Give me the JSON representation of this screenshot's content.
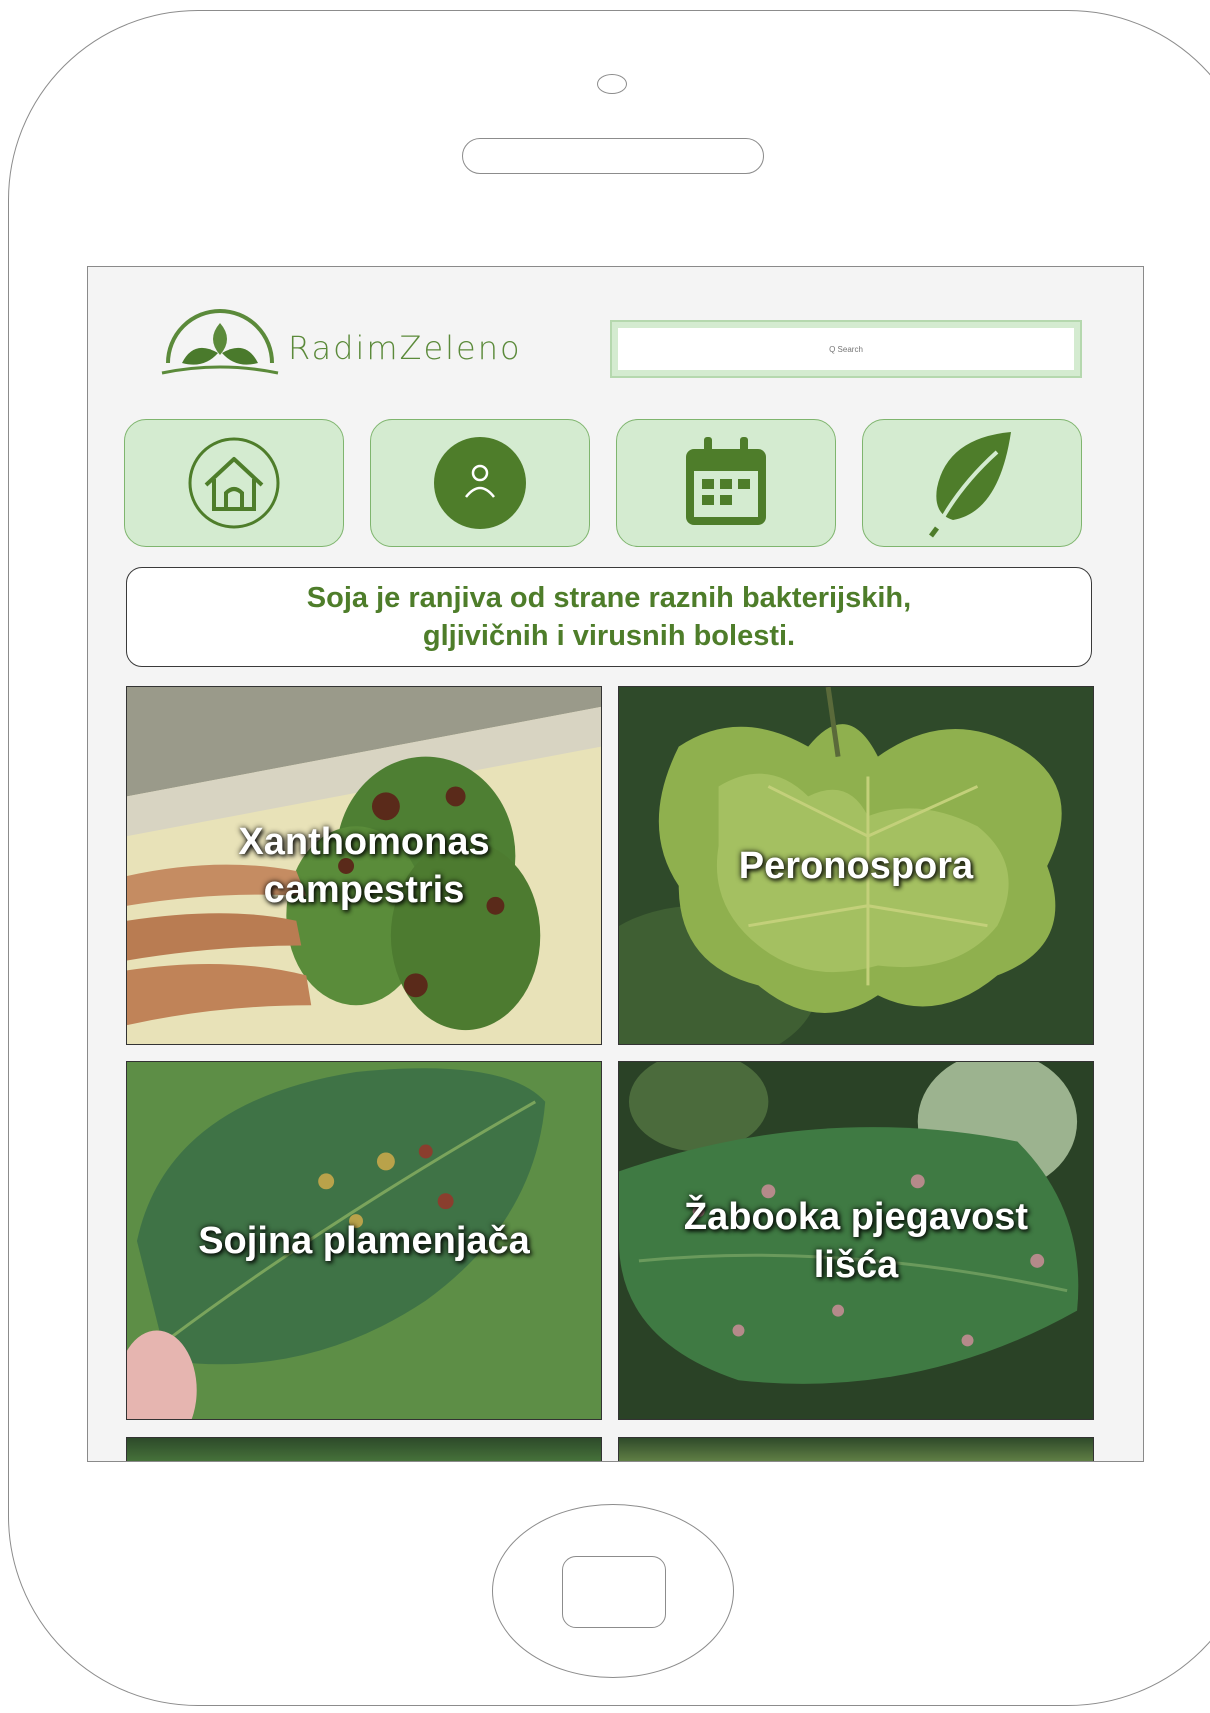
{
  "brand": {
    "name": "RadimZeleno"
  },
  "search": {
    "placeholder": "Q Search"
  },
  "nav": [
    {
      "icon": "home-icon"
    },
    {
      "icon": "user-icon"
    },
    {
      "icon": "calendar-icon"
    },
    {
      "icon": "leaf-icon"
    }
  ],
  "banner": {
    "text": "Soja je ranjiva od strane raznih bakterijskih, gljivičnih i virusnih bolesti."
  },
  "diseases": [
    {
      "label": "Xanthomonas campestris"
    },
    {
      "label": "Peronospora"
    },
    {
      "label": "Sojina plamenjača"
    },
    {
      "label": "Žabooka pjegavost lišća"
    }
  ],
  "colors": {
    "accent": "#5b8a3a",
    "nav_bg": "#d4ebd0",
    "dark_green": "#4e7d2a"
  }
}
